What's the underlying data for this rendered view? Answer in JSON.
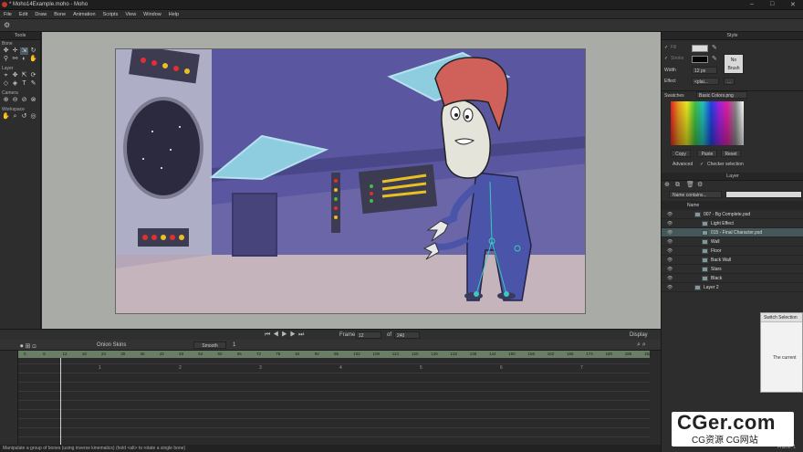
{
  "window": {
    "title": "* Moho14Example.moho - Moho"
  },
  "menu": [
    "File",
    "Edit",
    "Draw",
    "Bone",
    "Animation",
    "Scripts",
    "View",
    "Window",
    "Help"
  ],
  "tools": {
    "title": "Tools",
    "sections": [
      "Bone",
      "Layer",
      "Camera",
      "Workspace"
    ]
  },
  "style": {
    "title": "Style",
    "fill_label": "Fill",
    "stroke_label": "Stroke",
    "width_label": "Width",
    "width_value": "12 px",
    "effect_label": "Effect",
    "effect_value": "<plai...",
    "no_brush": "No Brush",
    "swatches_label": "Swatches",
    "swatches_value": "Basic Colors.png",
    "copy": "Copy",
    "paste": "Paste",
    "reset": "Reset",
    "advanced": "Advanced",
    "checker": "Checker selection"
  },
  "layers": {
    "title": "Layer",
    "filter_placeholder": "Name contains...",
    "col_name": "Name",
    "items": [
      {
        "name": "007 - Bg Complete.psd",
        "indent": 1,
        "selected": false
      },
      {
        "name": "Light Effect",
        "indent": 2,
        "selected": false
      },
      {
        "name": "015 - Final Character.psd",
        "indent": 2,
        "selected": true
      },
      {
        "name": "Wall",
        "indent": 2,
        "selected": false
      },
      {
        "name": "Floor",
        "indent": 2,
        "selected": false
      },
      {
        "name": "Back Wall",
        "indent": 2,
        "selected": false
      },
      {
        "name": "Stars",
        "indent": 2,
        "selected": false
      },
      {
        "name": "Black",
        "indent": 2,
        "selected": false
      },
      {
        "name": "Layer 2",
        "indent": 1,
        "selected": false
      }
    ]
  },
  "playbar": {
    "frame_label": "Frame",
    "frame_value": "12",
    "of_label": "of",
    "total": "240",
    "display": "Display"
  },
  "timeline": {
    "onion": "Onion Skins",
    "interp": "Smooth",
    "interp_n": "1",
    "ruler_ticks": [
      "0",
      "6",
      "12",
      "18",
      "24",
      "30",
      "36",
      "42",
      "48",
      "54",
      "60",
      "66",
      "72",
      "78",
      "84",
      "90",
      "96",
      "102",
      "108",
      "114",
      "120",
      "126",
      "132",
      "138",
      "144",
      "150",
      "156",
      "162",
      "168",
      "174",
      "180",
      "186",
      "192"
    ],
    "sec_marks": [
      "1",
      "2",
      "3",
      "4",
      "5",
      "6",
      "7"
    ]
  },
  "popup": {
    "title": "Switch Selection",
    "body": "The current"
  },
  "status": "Manipulate a group of bones (using inverse kinematics) (hold <alt> to rotate a single bone)",
  "frame_corner": "Frame: 1",
  "watermark": {
    "big": "CGer.com",
    "small": "CG资源  CG网站"
  },
  "colors": {
    "accent": "#6a7e66",
    "selected_layer": "#44585a",
    "bg": "#2b2b2b"
  }
}
